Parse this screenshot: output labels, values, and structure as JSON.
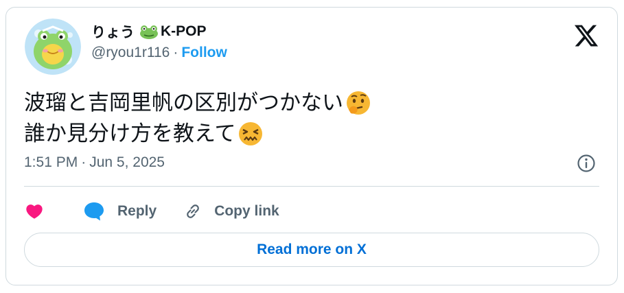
{
  "author": {
    "display_name": "りょう",
    "name_suffix": "K-POP",
    "handle": "@ryou1r116",
    "separator": "·",
    "follow_label": "Follow"
  },
  "tweet": {
    "line1": "波瑠と吉岡里帆の区別がつかない",
    "line2": "誰か見分け方を教えて",
    "time": "1:51 PM",
    "date_separator": "·",
    "date": "Jun 5, 2025"
  },
  "actions": {
    "reply_label": "Reply",
    "copy_label": "Copy link"
  },
  "read_more_label": "Read more on X",
  "icons": {
    "brand": "x-logo-icon",
    "like": "heart-icon",
    "reply": "speech-bubble-icon",
    "copy": "link-icon",
    "info": "info-icon",
    "emoji1": "thinking-face-emoji",
    "emoji2": "confounded-face-emoji",
    "name_emoji": "frog-emoji"
  },
  "colors": {
    "follow": "#1d9bf0",
    "like": "#f91880",
    "reply": "#1d9bf0",
    "read_more": "#006fd6",
    "muted": "#536471",
    "border": "#cfd9de"
  }
}
